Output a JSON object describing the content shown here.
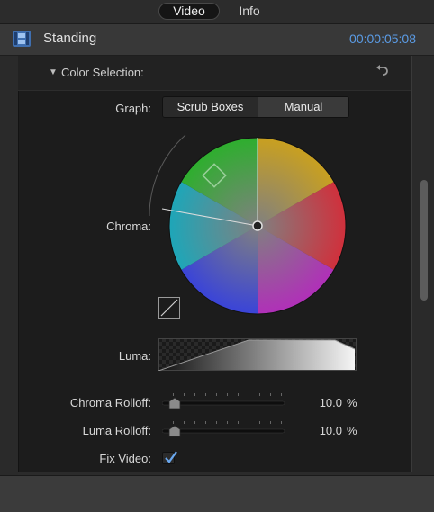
{
  "tabs": [
    {
      "label": "Video",
      "selected": true
    },
    {
      "label": "Info",
      "selected": false
    }
  ],
  "header": {
    "icon": "film-clip-icon",
    "title": "Standing",
    "timecode": "00:00:05:08"
  },
  "section": {
    "title": "Color Selection:",
    "expanded": true,
    "reset_icon": "reset-arrow-icon"
  },
  "graph": {
    "label": "Graph:",
    "options": [
      "Scrub Boxes",
      "Manual"
    ],
    "selected": "Manual"
  },
  "chroma": {
    "label": "Chroma:",
    "curve_icon": "curve-graph-icon"
  },
  "luma": {
    "label": "Luma:"
  },
  "chroma_rolloff": {
    "label": "Chroma Rolloff:",
    "value": "10.0",
    "unit": "%"
  },
  "luma_rolloff": {
    "label": "Luma Rolloff:",
    "value": "10.0",
    "unit": "%"
  },
  "fix_video": {
    "label": "Fix Video:",
    "checked": true
  },
  "colors": {
    "accent": "#5b9ce6",
    "panel": "#1c1c1c",
    "header": "#383838"
  }
}
